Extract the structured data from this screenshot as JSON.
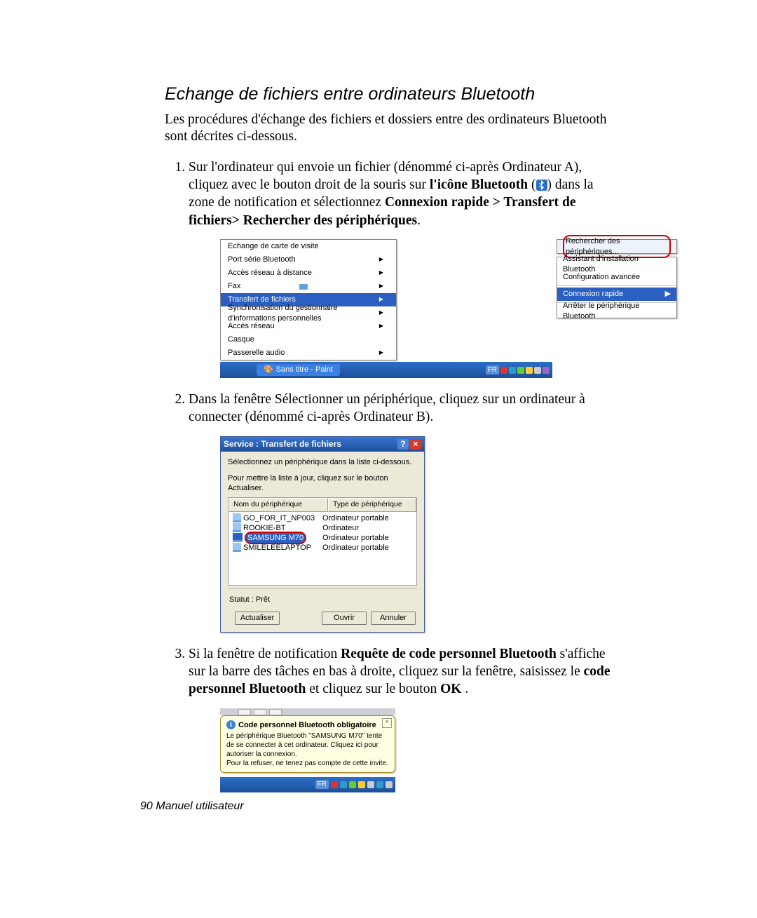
{
  "heading": "Echange de fichiers entre ordinateurs Bluetooth",
  "intro": "Les procédures d'échange des fichiers et dossiers entre des ordinateurs Bluetooth sont décrites ci-dessous.",
  "step1": {
    "a": "Sur l'ordinateur qui envoie un fichier (dénommé ci-après Ordinateur A), cliquez avec le bouton droit de la souris sur ",
    "b": "l'icône Bluetooth",
    "c": " (",
    "d": ") dans la zone de notification et sélectionnez ",
    "e": "Connexion rapide > Transfert de fichiers> Rechercher des périphériques",
    "f": "."
  },
  "step2": "Dans la fenêtre Sélectionner un périphérique, cliquez sur un ordinateur à connecter (dénommé ci-après Ordinateur B).",
  "step3": {
    "a": "Si la fenêtre de notification ",
    "b": "Requête de code personnel Bluetooth",
    "c": " s'affiche sur la barre des tâches en bas à droite, cliquez sur la fenêtre, saisissez le ",
    "d": "code personnel Bluetooth",
    "e": "  et cliquez sur le bouton ",
    "f": "OK",
    "g": " ."
  },
  "footer_page": "90",
  "footer_label": "  Manuel utilisateur",
  "fig1": {
    "left": [
      "Echange de carte de visite",
      "Port série Bluetooth",
      "Accès réseau à distance",
      "Fax",
      "Transfert de fichiers",
      "Synchronisation du gestionnaire d'informations personnelles",
      "Accès réseau",
      "Casque",
      "Passerelle audio"
    ],
    "right_top": "Rechercher des périphériques...",
    "right_assist": "Assistant d'installation Bluetooth",
    "right_conf": "Configuration avancée",
    "right_quick": "Connexion rapide",
    "right_stop": "Arrêter le périphérique Bluetooth",
    "taskbar_app": "Sans titre - Paint",
    "lang": "FR"
  },
  "fig2": {
    "title": "Service : Transfert de fichiers",
    "instr1": "Sélectionnez un périphérique dans la liste ci-dessous.",
    "instr2": "Pour mettre la liste à jour, cliquez sur le bouton Actualiser.",
    "col1": "Nom du périphérique",
    "col2": "Type de périphérique",
    "rows": [
      {
        "name": "GO_FOR_IT_NP003",
        "type": "Ordinateur portable"
      },
      {
        "name": "ROOKIE-BT",
        "type": "Ordinateur"
      },
      {
        "name": "SAMSUNG M70",
        "type": "Ordinateur portable"
      },
      {
        "name": "SMILELEELAPTOP",
        "type": "Ordinateur portable"
      }
    ],
    "status": "Statut : Prêt",
    "btn_refresh": "Actualiser",
    "btn_open": "Ouvrir",
    "btn_cancel": "Annuler"
  },
  "fig3": {
    "title": "Code personnel Bluetooth obligatoire",
    "body1": "Le périphérique Bluetooth \"SAMSUNG M70\" tente de se connecter à cet ordinateur. Cliquez ici pour autoriser la connexion.",
    "body2": "Pour la refuser, ne tenez pas compte de cette invite.",
    "lang": "FR"
  }
}
